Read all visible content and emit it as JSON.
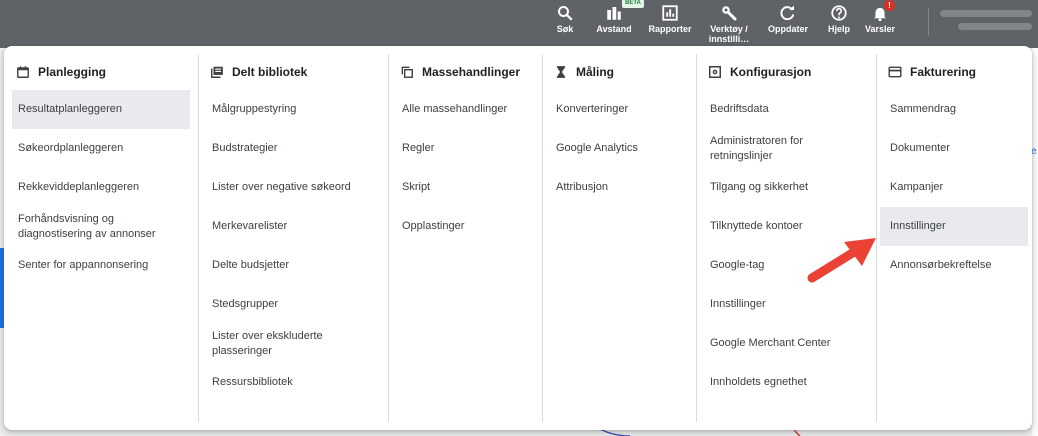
{
  "topbar": {
    "tools": [
      {
        "label": "Søk",
        "icon": "search-icon"
      },
      {
        "label": "Avstand",
        "icon": "bar-chart-icon",
        "badge": "BETA"
      },
      {
        "label": "Rapporter",
        "icon": "reports-icon"
      },
      {
        "label": "Verktøy / innstilli…",
        "icon": "wrench-icon"
      },
      {
        "label": "Oppdater",
        "icon": "refresh-icon"
      },
      {
        "label": "Hjelp",
        "icon": "help-icon"
      },
      {
        "label": "Varsler",
        "icon": "bell-icon",
        "badge": "!"
      }
    ]
  },
  "menu": {
    "columns": [
      {
        "title": "Planlegging",
        "icon": "calendar-icon",
        "items": [
          "Resultatplanleggeren",
          "Søkeordplanleggeren",
          "Rekkeviddeplanleggeren",
          "Forhåndsvisning og diagnostisering av annonser",
          "Senter for appannonsering"
        ]
      },
      {
        "title": "Delt bibliotek",
        "icon": "library-icon",
        "items": [
          "Målgruppestyring",
          "Budstrategier",
          "Lister over negative søkeord",
          "Merkevarelister",
          "Delte budsjetter",
          "Stedsgrupper",
          "Lister over ekskluderte plasseringer",
          "Ressursbibliotek"
        ]
      },
      {
        "title": "Massehandlinger",
        "icon": "copy-icon",
        "items": [
          "Alle massehandlinger",
          "Regler",
          "Skript",
          "Opplastinger"
        ]
      },
      {
        "title": "Måling",
        "icon": "hourglass-icon",
        "items": [
          "Konverteringer",
          "Google Analytics",
          "Attribusjon"
        ]
      },
      {
        "title": "Konfigurasjon",
        "icon": "settings-box-icon",
        "items": [
          "Bedriftsdata",
          "Administratoren for retningslinjer",
          "Tilgang og sikkerhet",
          "Tilknyttede kontoer",
          "Google-tag",
          "Innstillinger",
          "Google Merchant Center",
          "Innholdets egnethet"
        ]
      },
      {
        "title": "Fakturering",
        "icon": "credit-card-icon",
        "items": [
          "Sammendrag",
          "Dokumenter",
          "Kampanjer",
          "Innstillinger",
          "Annonsørbekreftelse"
        ]
      }
    ]
  },
  "selected_item": "Resultatplanleggeren",
  "highlighted_item": "Innstillinger",
  "colors": {
    "topbar": "#5f6368",
    "annotation_arrow": "#ea4335",
    "accent": "#1a73e8"
  }
}
